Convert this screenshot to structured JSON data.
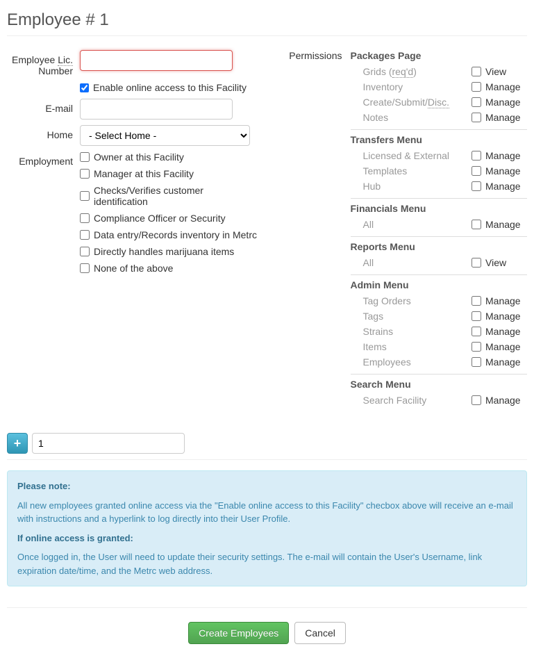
{
  "title": "Employee # 1",
  "labels": {
    "lic_number_pre": "Employee ",
    "lic_abbr": "Lic.",
    "lic_number_post": " Number",
    "enable_online": "Enable online access to this Facility",
    "email": "E-mail",
    "home": "Home",
    "home_placeholder": "- Select Home -",
    "employment": "Employment",
    "permissions": "Permissions"
  },
  "employment_options": [
    {
      "id": "owner",
      "label": "Owner at this Facility"
    },
    {
      "id": "manager",
      "label": "Manager at this Facility"
    },
    {
      "id": "checks",
      "label": "Checks/Verifies customer identification"
    },
    {
      "id": "compliance",
      "label": "Compliance Officer or Security"
    },
    {
      "id": "dataentry",
      "label": "Data entry/Records inventory in Metrc"
    },
    {
      "id": "handles",
      "label": "Directly handles marijuana items"
    },
    {
      "id": "none",
      "label": "None of the above"
    }
  ],
  "permission_groups": [
    {
      "title": "Packages Page",
      "items": [
        {
          "name_pre": "Grids (",
          "name_abbr": "req'd",
          "name_post": ")",
          "action": "View"
        },
        {
          "name": "Inventory",
          "action": "Manage"
        },
        {
          "name_pre": "Create/Submit/",
          "name_abbr": "Disc.",
          "action": "Manage"
        },
        {
          "name": "Notes",
          "action": "Manage"
        }
      ]
    },
    {
      "title": "Transfers Menu",
      "items": [
        {
          "name": "Licensed & External",
          "action": "Manage"
        },
        {
          "name": "Templates",
          "action": "Manage"
        },
        {
          "name": "Hub",
          "action": "Manage"
        }
      ]
    },
    {
      "title": "Financials Menu",
      "items": [
        {
          "name": "All",
          "action": "Manage"
        }
      ]
    },
    {
      "title": "Reports Menu",
      "items": [
        {
          "name": "All",
          "action": "View"
        }
      ]
    },
    {
      "title": "Admin Menu",
      "items": [
        {
          "name": "Tag Orders",
          "action": "Manage"
        },
        {
          "name": "Tags",
          "action": "Manage"
        },
        {
          "name": "Strains",
          "action": "Manage"
        },
        {
          "name": "Items",
          "action": "Manage"
        },
        {
          "name": "Employees",
          "action": "Manage"
        }
      ]
    },
    {
      "title": "Search Menu",
      "items": [
        {
          "name": "Search Facility",
          "action": "Manage"
        }
      ]
    }
  ],
  "add": {
    "count": "1"
  },
  "notes": {
    "heading1": "Please note:",
    "body1": "All new employees granted online access via the \"Enable online access to this Facility\" checbox above will receive an e-mail with instructions and a hyperlink to log directly into their User Profile.",
    "heading2": "If online access is granted:",
    "body2": "Once logged in, the User will need to update their security settings. The e-mail will contain the User's Username, link expiration date/time, and the Metrc web address."
  },
  "buttons": {
    "create": "Create Employees",
    "cancel": "Cancel"
  },
  "values": {
    "lic_number": "",
    "email": "",
    "enable_online": true
  }
}
